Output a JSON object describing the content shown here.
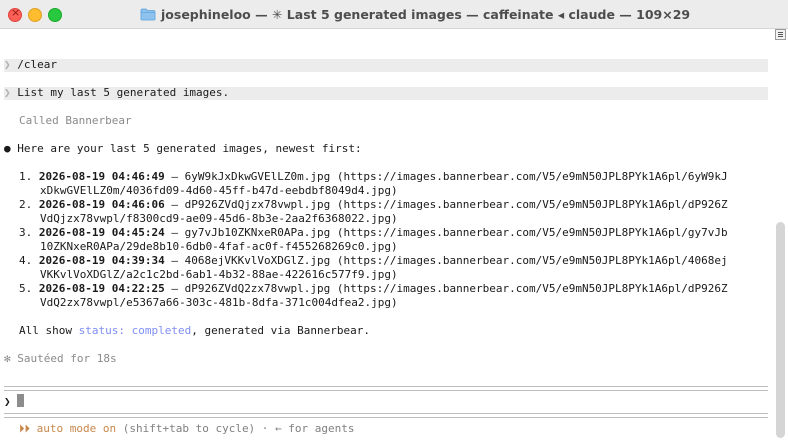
{
  "window": {
    "title": "josephineloo — ✳ Last 5 generated images — caffeinate ◂ claude — 109×29"
  },
  "icons": {
    "folder": "folder-icon",
    "close": "close-icon",
    "minimize": "minimize-icon",
    "zoom": "zoom-icon",
    "prompt": "prompt-chevron-icon",
    "scroll": "scroll-menu-icon",
    "mode": "fast-forward-icon"
  },
  "colors": {
    "accent_blue": "#7f8ef5",
    "mode_orange": "#c8874a",
    "close": "#fe5f57",
    "minimize": "#febc2e",
    "zoom": "#28c840"
  },
  "terminal": {
    "prompt_glyph": "❯",
    "cmd1": "/clear",
    "cmd2": "List my last 5 generated images.",
    "tool_call": "Called Bannerbear",
    "bullet": "●",
    "intro": "Here are your last 5 generated images, newest first:",
    "images": [
      {
        "num": "1.",
        "ts": "2026-08-19 04:46:49",
        "rest1": " — 6yW9kJxDkwGVElLZ0m.jpg (https://images.bannerbear.com/V5/e9mN50JPL8PYk1A6pl/6yW9kJ",
        "rest2": "xDkwGVElLZ0m/4036fd09-4d60-45ff-b47d-eebdbf8049d4.jpg)"
      },
      {
        "num": "2.",
        "ts": "2026-08-19 04:46:06",
        "rest1": " — dP926ZVdQjzx78vwpl.jpg (https://images.bannerbear.com/V5/e9mN50JPL8PYk1A6pl/dP926Z",
        "rest2": "VdQjzx78vwpl/f8300cd9-ae09-45d6-8b3e-2aa2f6368022.jpg)"
      },
      {
        "num": "3.",
        "ts": "2026-08-19 04:45:24",
        "rest1": " — gy7vJb10ZKNxeR0APa.jpg (https://images.bannerbear.com/V5/e9mN50JPL8PYk1A6pl/gy7vJb",
        "rest2": "10ZKNxeR0APa/29de8b10-6db0-4faf-ac0f-f455268269c0.jpg)"
      },
      {
        "num": "4.",
        "ts": "2026-08-19 04:39:34",
        "rest1": " — 4068ejVKKvlVoXDGlZ.jpg (https://images.bannerbear.com/V5/e9mN50JPL8PYk1A6pl/4068ej",
        "rest2": "VKKvlVoXDGlZ/a2c1c2bd-6ab1-4b32-88ae-422616c577f9.jpg)"
      },
      {
        "num": "5.",
        "ts": "2026-08-19 04:22:25",
        "rest1": " — dP926ZVdQ2zx78vwpl.jpg (https://images.bannerbear.com/V5/e9mN50JPL8PYk1A6pl/dP926Z",
        "rest2": "VdQ2zx78vwpl/e5367a66-303c-481b-8dfa-371c004dfea2.jpg)"
      }
    ],
    "summary_pre": "All show ",
    "summary_status": "status: completed",
    "summary_post": ", generated via Bannerbear.",
    "elapsed_glyph": "✻",
    "elapsed": "Sautéed for 18s",
    "input_value": ""
  },
  "footer": {
    "mode_glyph": "⏵⏵",
    "mode": "auto mode on",
    "hint": " (shift+tab to cycle) · ← for agents"
  }
}
